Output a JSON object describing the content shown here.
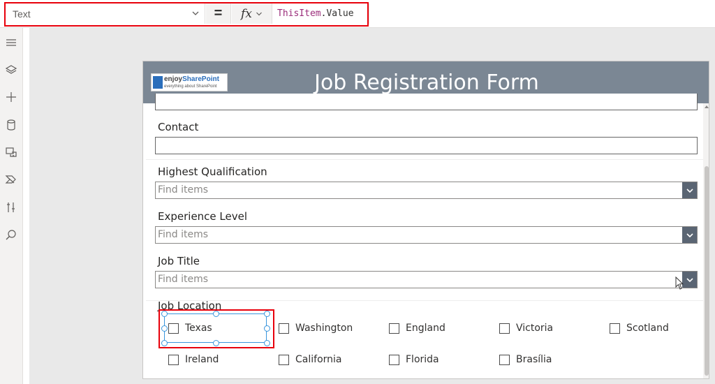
{
  "formula_bar": {
    "property": "Text",
    "equals": "=",
    "fx": "fx",
    "formula_object": "ThisItem",
    "formula_dot": ".",
    "formula_member": "Value"
  },
  "rail": {
    "icons": [
      "menu-icon",
      "layers-icon",
      "add-icon",
      "database-icon",
      "media-icon",
      "power-automate-icon",
      "tools-icon",
      "search-icon"
    ]
  },
  "form": {
    "logo_brand_a": "enjoy",
    "logo_brand_b": "SharePoint",
    "logo_tagline": "everything about SharePoint",
    "title": "Job Registration Form",
    "contact_label": "Contact",
    "qualification_label": "Highest Qualification",
    "qualification_placeholder": "Find items",
    "experience_label": "Experience Level",
    "experience_placeholder": "Find items",
    "jobtitle_label": "Job Title",
    "jobtitle_placeholder": "Find items",
    "location_label": "Job Location",
    "locations": [
      "Texas",
      "Washington",
      "England",
      "Victoria",
      "Scotland",
      "Ireland",
      "California",
      "Florida",
      "Brasília"
    ]
  },
  "colors": {
    "header_bg": "#7b8794",
    "highlight_red": "#e8000b",
    "selection_blue": "#3a96dd",
    "dropdown_bg": "#5a6573"
  }
}
